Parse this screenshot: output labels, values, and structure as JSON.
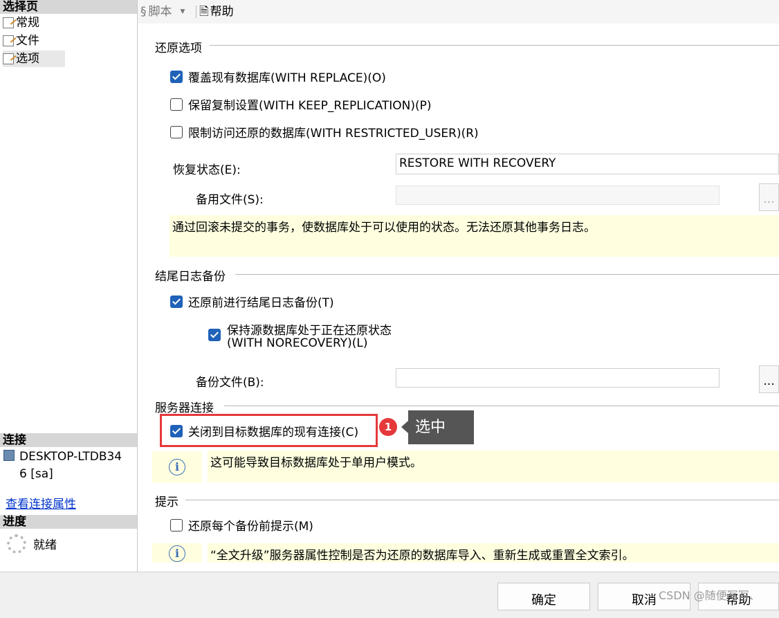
{
  "left": {
    "select_page_header": "选择页",
    "nav": [
      {
        "label": "常规"
      },
      {
        "label": "文件"
      },
      {
        "label": "选项"
      }
    ],
    "connection_header": "连接",
    "connection_server": "DESKTOP-LTDB34",
    "connection_server2": "6 [sa]",
    "view_conn_props": "查看连接属性",
    "progress_header": "进度",
    "progress_status": "就绪"
  },
  "toolbar": {
    "script_label": "脚本",
    "help_label": "帮助"
  },
  "restore_options": {
    "group_title": "还原选项",
    "overwrite": {
      "label": "覆盖现有数据库(WITH REPLACE)(O)",
      "checked": true
    },
    "keep_replication": {
      "label": "保留复制设置(WITH KEEP_REPLICATION)(P)",
      "checked": false
    },
    "restricted_user": {
      "label": "限制访问还原的数据库(WITH RESTRICTED_USER)(R)",
      "checked": false
    },
    "recovery_state_label": "恢复状态(E):",
    "recovery_state_value": "RESTORE WITH RECOVERY",
    "standby_file_label": "备用文件(S):",
    "standby_browse": "...",
    "recovery_note": "通过回滚未提交的事务，使数据库处于可以使用的状态。无法还原其他事务日志。"
  },
  "tail_log": {
    "group_title": "结尾日志备份",
    "backup_before": {
      "label": "还原前进行结尾日志备份(T)",
      "checked": true
    },
    "keep_norecovery_line1": "保持源数据库处于正在还原状态",
    "keep_norecovery_line2": "(WITH NORECOVERY)(L)",
    "keep_norecovery_checked": true,
    "backup_file_label": "备份文件(B):",
    "backup_browse": "..."
  },
  "server_conn": {
    "group_title": "服务器连接",
    "close_existing": {
      "label": "关闭到目标数据库的现有连接(C)",
      "checked": true
    },
    "note": "这可能导致目标数据库处于单用户模式。"
  },
  "prompt": {
    "group_title": "提示",
    "prompt_before": {
      "label": "还原每个备份前提示(M)",
      "checked": false
    },
    "note": "“全文升级”服务器属性控制是否为还原的数据库导入、重新生成或重置全文索引。"
  },
  "annotation": {
    "badge": "1",
    "tip": "选中",
    "highlight_color": "#e5383b"
  },
  "buttons": {
    "ok": "确定",
    "cancel": "取消",
    "help": "帮助"
  },
  "watermark": "CSDN @随便写写、",
  "colors": {
    "checkbox_checked": "#1f62b8",
    "note_bg": "#ffffe0",
    "link": "#0033cc"
  }
}
